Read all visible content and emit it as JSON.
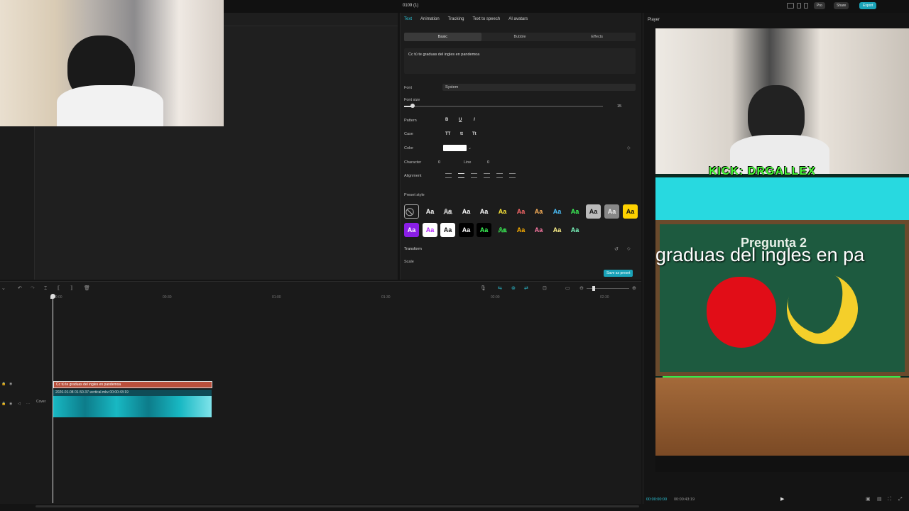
{
  "app": {
    "title": "0109 (1)"
  },
  "header": {
    "pro_label": "Pro",
    "share_label": "Share",
    "export_label": "Export"
  },
  "inspector": {
    "tabs": [
      "Text",
      "Animation",
      "Tracking",
      "Text to speech",
      "AI avatars"
    ],
    "subtabs": [
      "Basic",
      "Bubble",
      "Effects"
    ],
    "text_value": "Cc tú te graduas del ingles en pandemoa",
    "font_label": "Font",
    "font_value": "System",
    "font_size_label": "Font size",
    "font_size_value": "15",
    "pattern_label": "Pattern",
    "pattern_buttons": [
      "B",
      "U",
      "I"
    ],
    "case_label": "Case",
    "case_buttons": [
      "TT",
      "tt",
      "Tt"
    ],
    "color_label": "Color",
    "color_value": "#ffffff",
    "character_label": "Character",
    "character_value": "0",
    "line_label": "Line",
    "line_value": "0",
    "alignment_label": "Alignment",
    "preset_label": "Preset style",
    "preset_sample": "Aa",
    "transform_label": "Transform",
    "scale_label": "Scale",
    "save_preset_label": "Save as preset"
  },
  "player": {
    "title": "Player",
    "overlay_name": "KICK: DRGALLEX",
    "question": "Pregunta 2",
    "caption": "graduas del ingles en pa",
    "current_time": "00:00:00:00",
    "total_time": "00:00:43:19"
  },
  "timeline": {
    "ruler": [
      "00:00",
      "00:30",
      "01:00",
      "01:30",
      "02:00",
      "02:30"
    ],
    "text_clip": "Cc tú te graduas del ingles en pandemoa",
    "video_clip": "2026-01-08 01-50-37-vertical.mkv  00:00:43:19",
    "cover_label": "Cover"
  },
  "colors": {
    "accent": "#2cc6d9",
    "export": "#1aa3b8",
    "text_clip": "#b9503c"
  }
}
